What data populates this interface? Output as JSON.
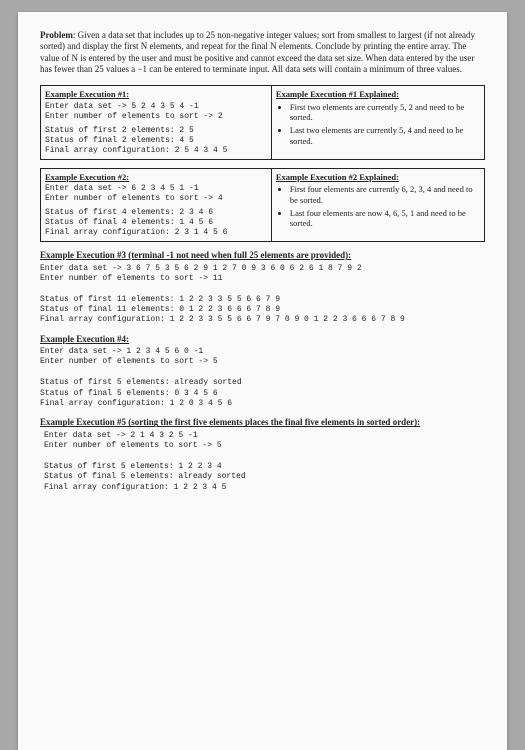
{
  "problem": {
    "label": "Problem",
    "text": ": Given a data set that includes up to 25 non-negative integer values; sort from smallest to largest (if not already sorted) and display the first N elements, and repeat for the final N elements. Conclude by printing the entire array. The value of N is entered by the user and must be positive and cannot exceed the data set size. When data entered by the user has fewer than 25 values a −1 can be entered to terminate input. All data sets will contain a minimum of three values."
  },
  "ex1": {
    "head": "Example Execution #1:",
    "l1": "Enter data set -> 5 2 4 3 5 4 -1",
    "l2": "Enter number of elements to sort -> 2",
    "l3": "Status of first 2 elements: 2 5",
    "l4": "Status of final 2 elements: 4 5",
    "l5": "Final array configuration: 2 5 4 3 4 5",
    "explhead": "Example Execution #1 Explained:",
    "b1": "First two elements are currently 5, 2 and need to be sorted.",
    "b2": "Last two elements are currently 5, 4 and need to be sorted."
  },
  "ex2": {
    "head": "Example Execution #2:",
    "l1": "Enter data set -> 6 2 3 4 5 1 -1",
    "l2": "Enter number of elements to sort -> 4",
    "l3": "Status of first 4 elements: 2 3 4 6",
    "l4": "Status of final 4 elements: 1 4 5 6",
    "l5": "Final array configuration: 2 3 1 4 5 6",
    "explhead": "Example Execution #2 Explained:",
    "b1": "First four elements are currently 6, 2, 3, 4 and need to be sorted.",
    "b2": "Last four elements are now 4, 6, 5, 1 and need to be sorted."
  },
  "ex3": {
    "head": "Example Execution #3 (terminal -1 not need when full 25 elements are provided):",
    "l1": "Enter data set -> 3 6 7 5 3 5 6 2 9 1 2 7 0 9 3 6 0 6 2 6 1 8 7 9 2",
    "l2": "Enter number of elements to sort -> 11",
    "l3": "Status of first 11 elements: 1 2 2 3 3 5 5 6 6 7 9",
    "l4": "Status of final 11 elements: 0 1 2 2 3 6 6 6 7 8 9",
    "l5": "Final array configuration: 1 2 2 3 3 5 5 6 6 7 9 7 0 9 0 1 2 2 3 6 6 6 7 8 9"
  },
  "ex4": {
    "head": "Example Execution #4:",
    "l1": "Enter data set -> 1 2 3 4 5 6 0 -1",
    "l2": "Enter number of elements to sort -> 5",
    "l3": "Status of first 5 elements: already sorted",
    "l4": "Status of final 5 elements: 0 3 4 5 6",
    "l5": "Final array configuration: 1 2 0 3 4 5 6"
  },
  "ex5": {
    "head": "Example Execution #5 (sorting the first five elements places the final five elements in sorted order):",
    "l1": "Enter data set -> 2 1 4 3 2 5 -1",
    "l2": "Enter number of elements to sort -> 5",
    "l3": "Status of first 5 elements: 1 2 2 3 4",
    "l4": "Status of final 5 elements: already sorted",
    "l5": "Final array configuration: 1 2 2 3 4 5"
  }
}
